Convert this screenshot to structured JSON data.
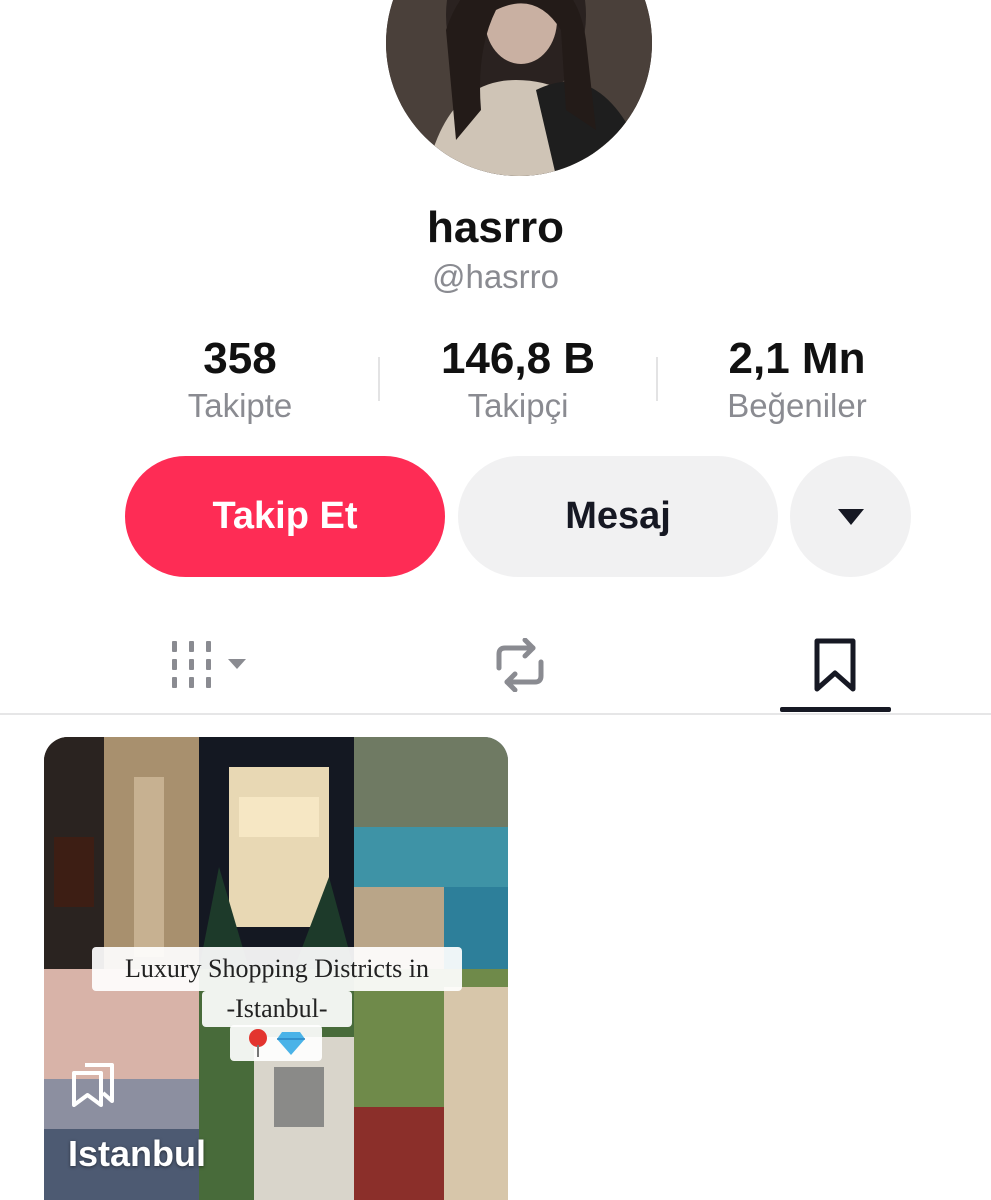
{
  "profile": {
    "display_name": "hasrro",
    "username": "@hasrro"
  },
  "stats": [
    {
      "value": "358",
      "label": "Takipte"
    },
    {
      "value": "146,8 B",
      "label": "Takipçi"
    },
    {
      "value": "2,1 Mn",
      "label": "Beğeniler"
    }
  ],
  "actions": {
    "follow_label": "Takip Et",
    "message_label": "Mesaj",
    "more_icon": "caret-down-icon"
  },
  "tabs": [
    {
      "icon": "videos-grid-icon",
      "active": false
    },
    {
      "icon": "repost-icon",
      "active": false
    },
    {
      "icon": "bookmark-icon",
      "active": true
    }
  ],
  "collection": {
    "title": "Istanbul",
    "overlay_line1": "Luxury Shopping Districts in",
    "overlay_line2": "-Istanbul-",
    "overlay_emoji": [
      "📍",
      "💎"
    ]
  },
  "colors": {
    "accent": "#fe2c55",
    "secondary_button": "#f1f1f2",
    "muted_text": "#8a8b91"
  }
}
